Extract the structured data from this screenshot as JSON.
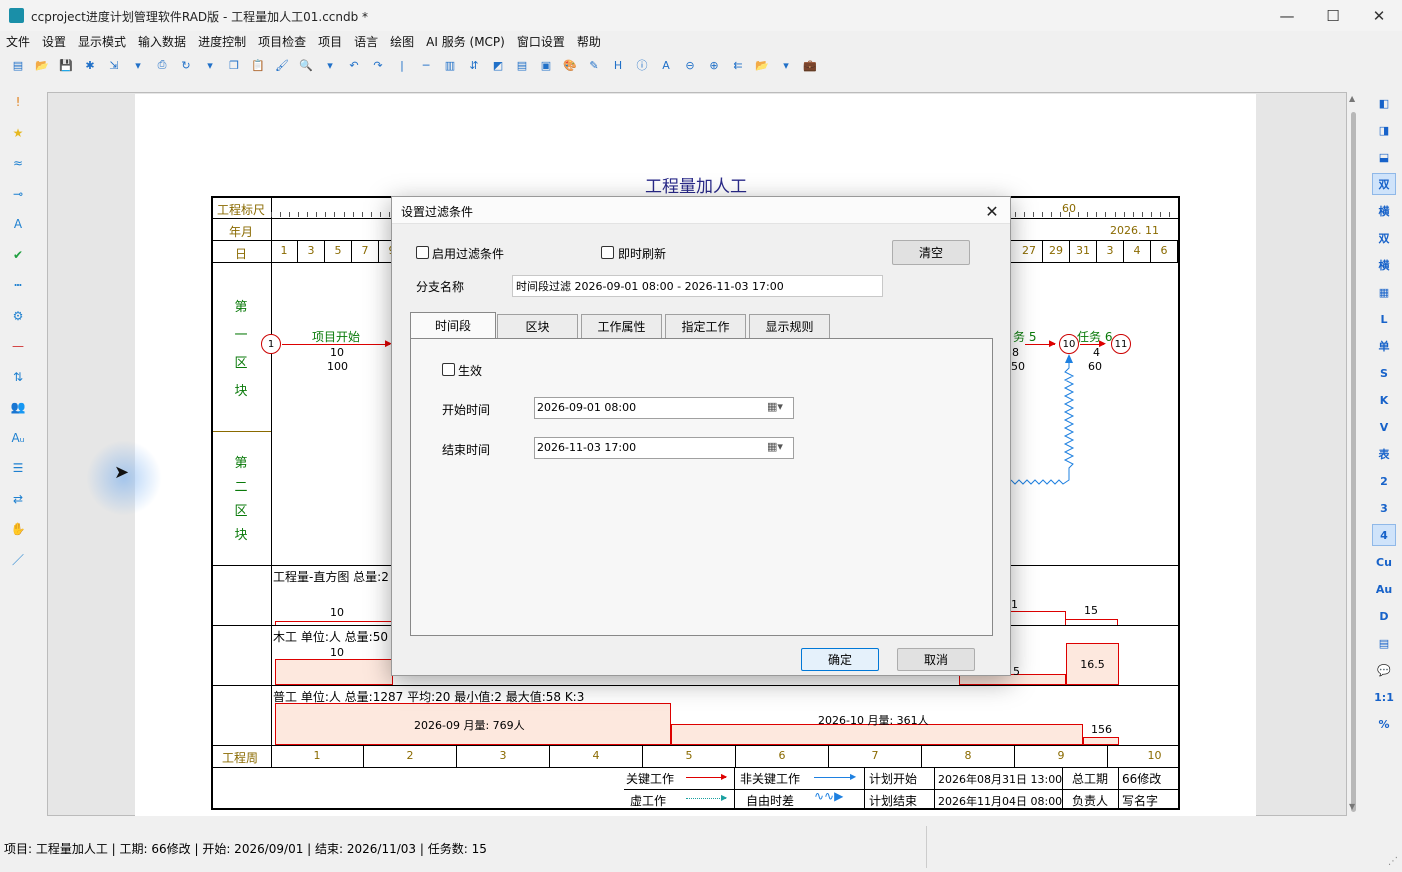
{
  "window": {
    "title": "ccproject进度计划管理软件RAD版 - 工程量加人工01.ccndb *",
    "minimize_glyph": "—",
    "maximize_glyph": "☐",
    "close_glyph": "✕"
  },
  "menu": [
    "文件",
    "设置",
    "显示模式",
    "输入数据",
    "进度控制",
    "项目检查",
    "项目",
    "语言",
    "绘图",
    "AI 服务 (MCP)",
    "窗口设置",
    "帮助"
  ],
  "toolbar_icons": [
    "new-file-icon",
    "open-folder-icon",
    "save-icon",
    "snowflake-icon",
    "export-icon",
    "dropdown-arrow-icon",
    "print-icon",
    "refresh-icon",
    "dropdown-arrow-icon",
    "copy-icon",
    "paste-icon",
    "format-painter-icon",
    "zoom-icon",
    "dropdown-arrow-icon",
    "undo-icon",
    "redo-icon",
    "separator-icon",
    "line-icon",
    "columns-icon",
    "sort-icon",
    "contrast-icon",
    "paint-icon",
    "report-icon",
    "palette-icon",
    "edit-icon",
    "h-icon",
    "info-icon",
    "text-a-icon",
    "zoom-out-icon",
    "zoom-in-icon",
    "arrows-icon",
    "open-folder-icon",
    "dropdown-arrow-icon",
    "briefcase-icon"
  ],
  "leftbar_icons": [
    {
      "name": "exclamation-icon",
      "glyph": "!",
      "color": "#e0801a"
    },
    {
      "name": "star-icon",
      "glyph": "★",
      "color": "#e6b820"
    },
    {
      "name": "wave-icon",
      "glyph": "≈",
      "color": "#1e80d0"
    },
    {
      "name": "link-icon",
      "glyph": "⊸",
      "color": "#1e80d0"
    },
    {
      "name": "text-style-icon",
      "glyph": "A",
      "color": "#1e80d0"
    },
    {
      "name": "check-icon",
      "glyph": "✔",
      "color": "#20a040"
    },
    {
      "name": "dotted-line-icon",
      "glyph": "┅",
      "color": "#1e80d0"
    },
    {
      "name": "gear-icon",
      "glyph": "⚙",
      "color": "#1e80d0"
    },
    {
      "name": "dash-icon",
      "glyph": "—",
      "color": "#d03030"
    },
    {
      "name": "sort-icon",
      "glyph": "⇅",
      "color": "#1e80d0"
    },
    {
      "name": "people-icon",
      "glyph": "👥",
      "color": "#20a040"
    },
    {
      "name": "font-size-icon",
      "glyph": "Aᵤ",
      "color": "#1e80d0"
    },
    {
      "name": "filter-icon",
      "glyph": "☰",
      "color": "#1e80d0"
    },
    {
      "name": "swap-icon",
      "glyph": "⇄",
      "color": "#1e80d0"
    },
    {
      "name": "hand-icon",
      "glyph": "✋",
      "color": "#222"
    },
    {
      "name": "pen-icon",
      "glyph": "／",
      "color": "#1e80d0"
    }
  ],
  "rightbar": [
    {
      "name": "panel-left-icon",
      "text": "◧",
      "sel": false
    },
    {
      "name": "panel-right-icon",
      "text": "◨",
      "sel": false
    },
    {
      "name": "panel-bottom-icon",
      "text": "⬓",
      "sel": false
    },
    {
      "name": "mode-shuang-button",
      "text": "双",
      "sel": true
    },
    {
      "name": "mode-heng-button",
      "text": "横",
      "sel": false
    },
    {
      "name": "mode-shuang2-button",
      "text": "双",
      "sel": false
    },
    {
      "name": "mode-heng2-button",
      "text": "横",
      "sel": false
    },
    {
      "name": "table-icon",
      "text": "▦",
      "sel": false
    },
    {
      "name": "mode-l-button",
      "text": "L",
      "sel": false
    },
    {
      "name": "mode-dan-button",
      "text": "单",
      "sel": false
    },
    {
      "name": "mode-s-button",
      "text": "S",
      "sel": false
    },
    {
      "name": "mode-k-button",
      "text": "K",
      "sel": false
    },
    {
      "name": "mode-v-button",
      "text": "V",
      "sel": false
    },
    {
      "name": "mode-biao-button",
      "text": "表",
      "sel": false
    },
    {
      "name": "level-2-button",
      "text": "2",
      "sel": false
    },
    {
      "name": "level-3-button",
      "text": "3",
      "sel": false
    },
    {
      "name": "level-4-button",
      "text": "4",
      "sel": true
    },
    {
      "name": "cu-button",
      "text": "Cu",
      "sel": false
    },
    {
      "name": "au-button",
      "text": "Au",
      "sel": false
    },
    {
      "name": "mode-d-button",
      "text": "D",
      "sel": false
    },
    {
      "name": "calc-icon",
      "text": "▤",
      "sel": false
    },
    {
      "name": "comment-icon",
      "text": "💬",
      "sel": false
    },
    {
      "name": "ratio-button",
      "text": "1:1",
      "sel": false
    },
    {
      "name": "percent-button",
      "text": "%",
      "sel": false
    }
  ],
  "chart": {
    "title": "工程量加人工",
    "row_labels": {
      "ruler": "工程标尺",
      "month": "年月",
      "day": "日",
      "week": "工程周"
    },
    "ruler_value": "60",
    "month_label": "2026. 11",
    "days_left": [
      "1",
      "3",
      "5",
      "7",
      "9"
    ],
    "days_right": [
      "27",
      "29",
      "31",
      "3",
      "4",
      "6"
    ],
    "block1": [
      "第",
      "一",
      "区",
      "块"
    ],
    "block2": [
      "第",
      "二",
      "区",
      "块"
    ],
    "node1": "1",
    "node10": "10",
    "node11": "11",
    "task_start_label": "项目开始",
    "task_start_dur": "10",
    "task_start_qty": "100",
    "task5_label": "务 5",
    "task5_dur": "8",
    "task5_qty": "50",
    "task6_label": "任务 6",
    "task6_dur": "4",
    "task6_qty": "60",
    "histogram_label": "工程量-直方图 总量:2",
    "hist_left_value": "10",
    "hist_right_a": "1",
    "hist_right_b": "15",
    "carpenter_label": "木工 单位:人 总量:50",
    "carp_left_value": "10",
    "carp_right_a": "5",
    "carp_right_b": "16.5",
    "laborer_label": "普工 单位:人 总量:1287 平均:20 最小值:2 最大值:58 K:3",
    "laborer_sep": "2026-09 月量: 769人",
    "laborer_oct": "2026-10 月量: 361人",
    "laborer_end": "156",
    "weeks": [
      "1",
      "2",
      "3",
      "4",
      "5",
      "6",
      "7",
      "8",
      "9",
      "10"
    ],
    "legend": {
      "critical": "关键工作",
      "noncritical": "非关键工作",
      "plan_start": "计划开始",
      "plan_start_val": "2026年08月31日 13:00",
      "total": "总工期",
      "total_val": "66修改",
      "dummy": "虚工作",
      "float": "自由时差",
      "plan_end": "计划结束",
      "plan_end_val": "2026年11月04日 08:00",
      "owner": "负责人",
      "owner_val": "写名字"
    }
  },
  "dialog": {
    "title": "设置过滤条件",
    "enable_filter": "启用过滤条件",
    "instant_refresh": "即时刷新",
    "clear_label": "清空",
    "branch_label": "分支名称",
    "branch_value": "时间段过滤 2026-09-01 08:00 - 2026-11-03 17:00",
    "tabs": [
      "时间段",
      "区块",
      "工作属性",
      "指定工作",
      "显示规则"
    ],
    "effective": "生效",
    "start_label": "开始时间",
    "start_value": "2026-09-01 08:00",
    "end_label": "结束时间",
    "end_value": "2026-11-03 17:00",
    "ok_label": "确定",
    "cancel_label": "取消"
  },
  "status": "项目: 工程量加人工 | 工期: 66修改 | 开始: 2026/09/01 | 结束: 2026/11/03 | 任务数: 15"
}
